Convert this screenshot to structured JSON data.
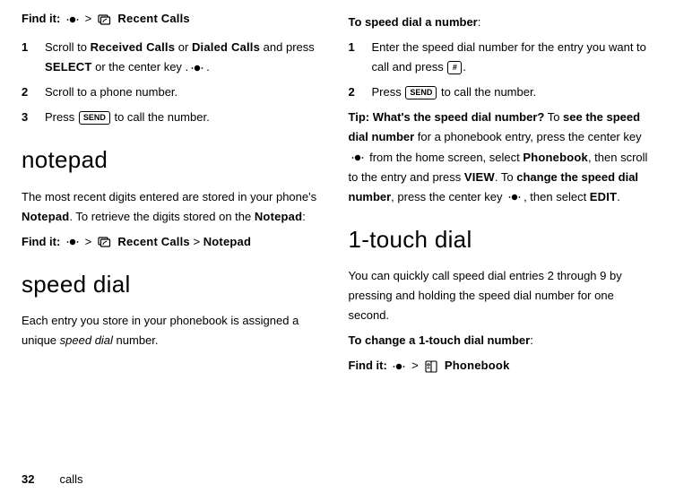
{
  "left": {
    "find1": {
      "label": "Find it:",
      "sep": ">",
      "menu": "Recent Calls"
    },
    "step1": {
      "num": "1",
      "t1": "Scroll to ",
      "rc": "Received Calls",
      "or": " or ",
      "dc": "Dialed Calls",
      "t2": " and press ",
      "select": "SELECT",
      "t3": " or the center key .",
      "period": "."
    },
    "step2": {
      "num": "2",
      "text": "Scroll to a phone number."
    },
    "step3": {
      "num": "3",
      "t1": "Press ",
      "key": "SEND",
      "t2": " to call the number."
    },
    "h_notepad": "notepad",
    "np_p1a": "The most recent digits entered are stored in your phone's ",
    "np_notepad": "Notepad",
    "np_p1b": ". To retrieve the digits stored on the ",
    "np_notepad2": "Notepad",
    "np_p1c": ":",
    "find2": {
      "label": "Find it:",
      "sep": ">",
      "menu": "Recent Calls",
      "sep2": ">",
      "menu2": "Notepad"
    },
    "h_speed": "speed dial",
    "sd_p1a": "Each entry you store in your phonebook is assigned a unique ",
    "sd_italic": "speed dial",
    "sd_p1b": " number."
  },
  "right": {
    "h_tospeed": "To speed dial a number",
    "colon": ":",
    "step1": {
      "num": "1",
      "t1": "Enter the speed dial number for the entry you want to call and press ",
      "key": "#",
      "period": "."
    },
    "step2": {
      "num": "2",
      "t1": "Press ",
      "key": "SEND",
      "t2": " to call the number."
    },
    "tip_a": "Tip: What's the speed dial number?",
    "tip_b": " To ",
    "tip_c": "see the speed dial number",
    "tip_d": " for a phonebook entry, press the center key ",
    "tip_e": " from the home screen, select ",
    "tip_pb": "Phonebook",
    "tip_f": ", then scroll to the entry and press ",
    "tip_view": "VIEW",
    "tip_g": ". To ",
    "tip_h": "change the speed dial number",
    "tip_i": ", press the center key ",
    "tip_j": ", then select ",
    "tip_edit": "EDIT",
    "tip_k": ".",
    "h_1touch": "1-touch dial",
    "t1_p": "You can quickly call speed dial entries 2 through 9 by pressing and holding the speed dial number for one second.",
    "h_change1t": "To change a 1-touch dial number",
    "find3": {
      "label": "Find it:",
      "sep": ">",
      "menu": "Phonebook"
    }
  },
  "footer": {
    "page": "32",
    "section": "calls"
  }
}
